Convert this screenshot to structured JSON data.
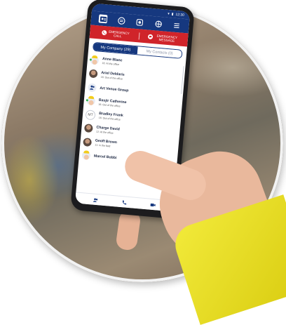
{
  "status_bar": {
    "time": "12:30"
  },
  "emergency": {
    "call_label": "EMERGENCY CALL",
    "message_label": "EMERGENCY MESSAGE"
  },
  "tabs": {
    "company": "My Company (29)",
    "contacts": "My Contacts (0)"
  },
  "contacts": [
    {
      "name": "Anne Blanc",
      "status": "16: At the office",
      "avatar": "hardhat",
      "online": true
    },
    {
      "name": "Ariel Deldaris",
      "status": "16: Out of the office",
      "avatar": "photo",
      "online": false
    },
    {
      "name": "Art Venue Group",
      "status": "",
      "avatar": "group",
      "online": false
    },
    {
      "name": "Basjir Catherine",
      "status": "16: Out of the office",
      "avatar": "hardhat",
      "online": true
    },
    {
      "name": "Bradley Frank",
      "status": "16: Out of the office",
      "avatar": "initials",
      "initials": "MT",
      "online": false
    },
    {
      "name": "Charge David",
      "status": "12: At the office",
      "avatar": "photo",
      "online": false
    },
    {
      "name": "Geoff Brown",
      "status": "11: in the field",
      "avatar": "photo",
      "online": false
    },
    {
      "name": "Marcel Bobbi",
      "status": "",
      "avatar": "hardhat",
      "online": false
    }
  ],
  "colors": {
    "header": "#16387f",
    "emergency": "#d0242a",
    "sleeve": "#f2ea3a"
  }
}
